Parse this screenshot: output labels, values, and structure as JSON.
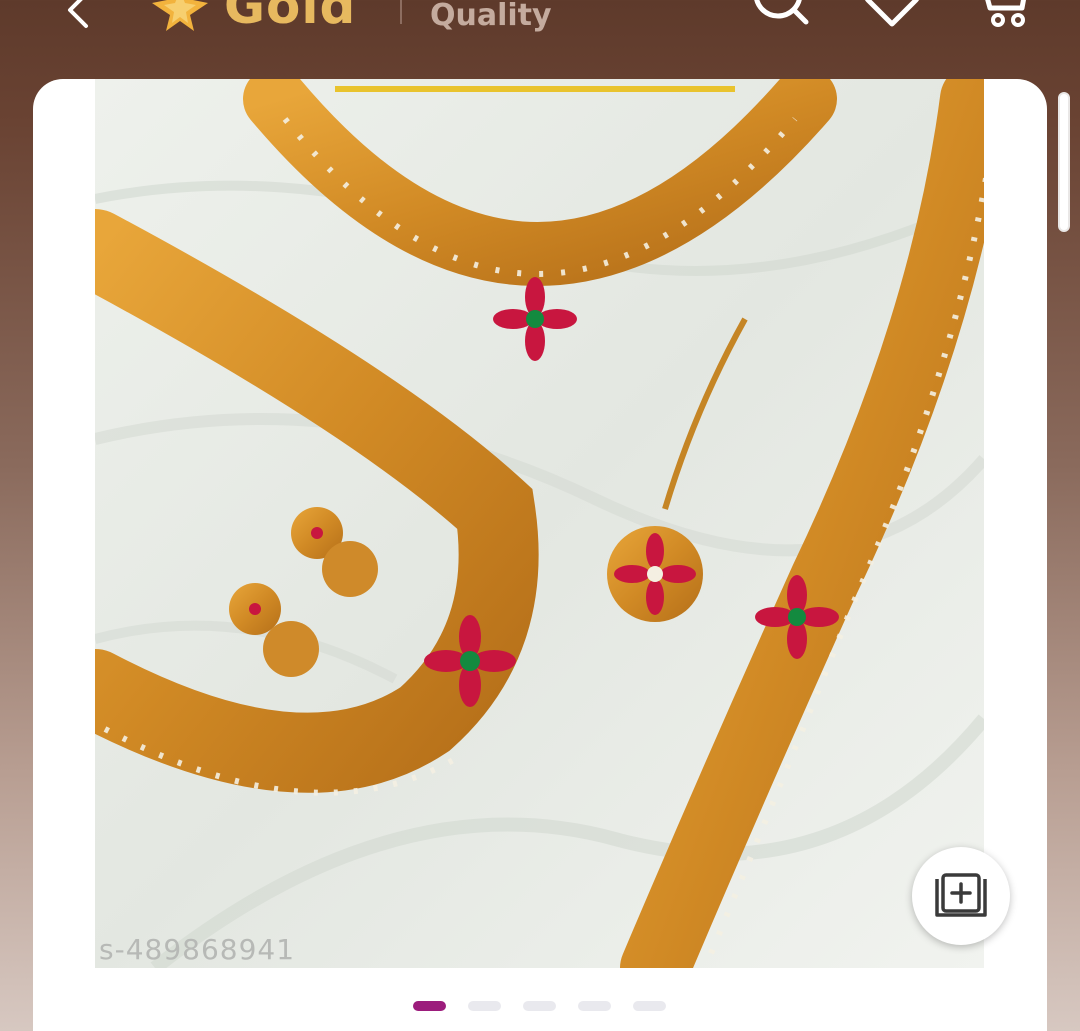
{
  "header": {
    "brand_name": "Gold",
    "brand_tagline": "Quality",
    "back_icon": "chevron-left-icon",
    "search_icon": "search-icon",
    "wishlist_icon": "heart-icon",
    "cart_icon": "cart-icon"
  },
  "product": {
    "image_id": "s-489868941",
    "add_to_catalog_icon": "add-to-catalog-icon",
    "carousel": {
      "total": 5,
      "active": 1
    }
  },
  "colors": {
    "header_bg": "#5e3a2b",
    "brand_gold": "#e7b95f",
    "carousel_active": "#9c1c7c",
    "carousel_inactive": "#e9e9ee"
  }
}
